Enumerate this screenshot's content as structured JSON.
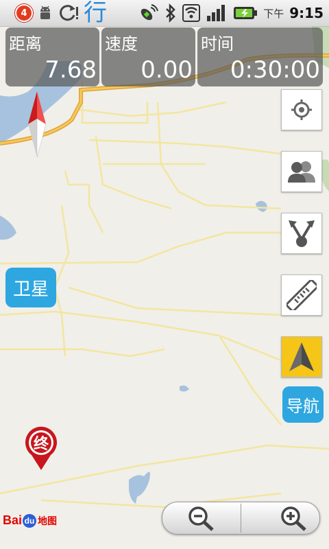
{
  "status_bar": {
    "notification_count": "4",
    "app_char": "行",
    "time_period": "下午",
    "time": "9:15",
    "icons": [
      "notification-badge-icon",
      "android-debug-icon",
      "sync-alert-icon",
      "gps-icon",
      "bluetooth-icon",
      "wifi-icon",
      "signal-icon",
      "battery-icon"
    ]
  },
  "stats": {
    "distance": {
      "label": "距离",
      "value": "7.68"
    },
    "speed": {
      "label": "速度",
      "value": "0.00"
    },
    "time": {
      "label": "时间",
      "value": "0:30:00"
    }
  },
  "controls": {
    "satellite_label": "卫星",
    "navigation_label": "导航",
    "side_buttons": [
      "locate-icon",
      "friends-icon",
      "share-icon",
      "ruler-icon",
      "compass-arrow-icon"
    ]
  },
  "map": {
    "end_marker_label": "终",
    "logo": {
      "bai": "Bai",
      "du": "du",
      "text": "地图"
    }
  },
  "colors": {
    "accent_blue": "#2ea7e0",
    "route_orange": "#f2b43a",
    "end_marker_red": "#c8161d",
    "water": "#a6c2de",
    "nav_button_yellow": "#f5c518"
  }
}
